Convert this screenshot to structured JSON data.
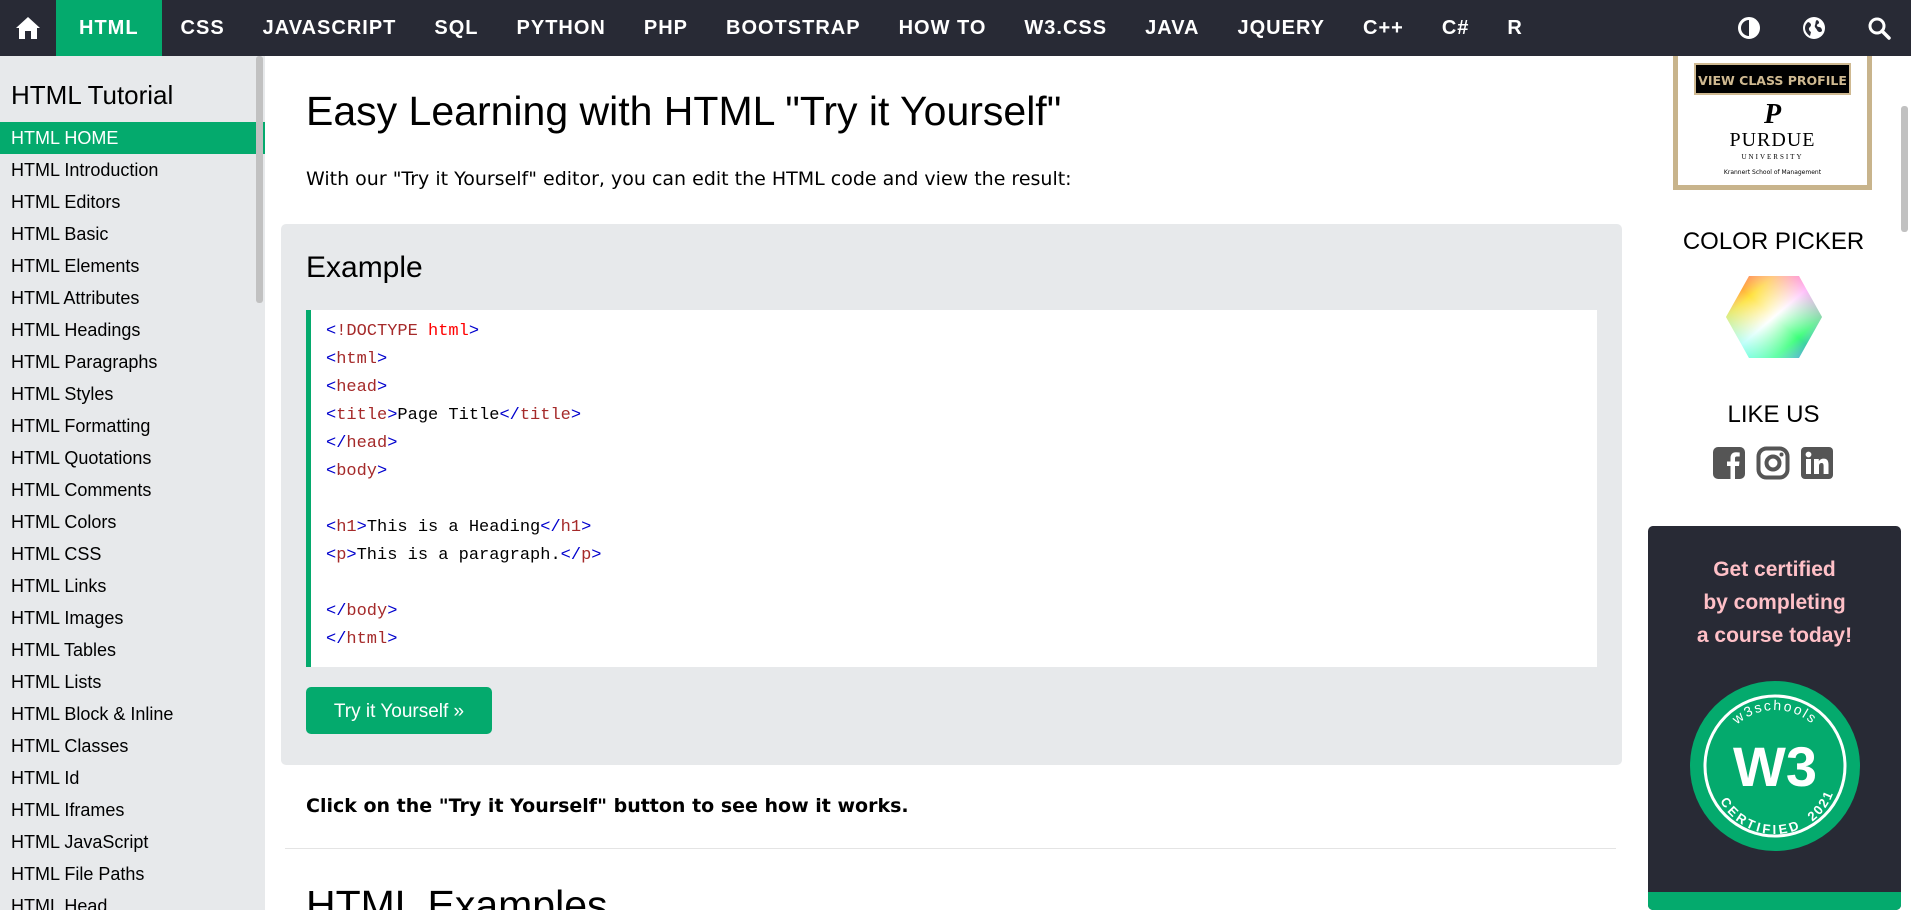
{
  "nav": {
    "items": [
      "HTML",
      "CSS",
      "JAVASCRIPT",
      "SQL",
      "PYTHON",
      "PHP",
      "BOOTSTRAP",
      "HOW TO",
      "W3.CSS",
      "JAVA",
      "JQUERY",
      "C++",
      "C#",
      "R"
    ],
    "active_item": "HTML",
    "icons": [
      "home-icon",
      "contrast-icon",
      "globe-icon",
      "search-icon"
    ]
  },
  "sidebar": {
    "title": "HTML Tutorial",
    "active_link": "HTML HOME",
    "links": [
      "HTML HOME",
      "HTML Introduction",
      "HTML Editors",
      "HTML Basic",
      "HTML Elements",
      "HTML Attributes",
      "HTML Headings",
      "HTML Paragraphs",
      "HTML Styles",
      "HTML Formatting",
      "HTML Quotations",
      "HTML Comments",
      "HTML Colors",
      "HTML CSS",
      "HTML Links",
      "HTML Images",
      "HTML Tables",
      "HTML Lists",
      "HTML Block & Inline",
      "HTML Classes",
      "HTML Id",
      "HTML Iframes",
      "HTML JavaScript",
      "HTML File Paths",
      "HTML Head"
    ]
  },
  "main": {
    "heading": "Easy Learning with HTML \"Try it Yourself\"",
    "intro": "With our \"Try it Yourself\" editor, you can edit the HTML code and view the result:",
    "example": {
      "title": "Example",
      "code_lines": [
        "<!DOCTYPE html>",
        "<html>",
        "<head>",
        "<title>Page Title</title>",
        "</head>",
        "<body>",
        "",
        "<h1>This is a Heading</h1>",
        "<p>This is a paragraph.</p>",
        "",
        "</body>",
        "</html>"
      ],
      "button_label": "Try it Yourself »"
    },
    "click_note": "Click on the \"Try it Yourself\" button to see how it works.",
    "next_heading": "HTML Examples"
  },
  "right": {
    "ad": {
      "banner": "VIEW CLASS PROFILE",
      "logo_letter": "P",
      "wordmark": "PURDUE",
      "sub": "UNIVERSITY",
      "school": "Krannert School of Management"
    },
    "color_picker_title": "COLOR PICKER",
    "like_us_title": "LIKE US",
    "social_icons": [
      "facebook-icon",
      "instagram-icon",
      "linkedin-icon"
    ],
    "cert": {
      "lines": [
        "Get certified",
        "by completing",
        "a course today!"
      ],
      "badge_top": "w3schools",
      "badge_bottom": "CERTIFIED",
      "badge_year": "2021",
      "badge_mark": "W3"
    }
  },
  "colors": {
    "nav_bg": "#282A35",
    "accent_green": "#04AA6D",
    "sidebar_bg": "#E7E9EB",
    "cert_text": "#FFC0C7"
  }
}
